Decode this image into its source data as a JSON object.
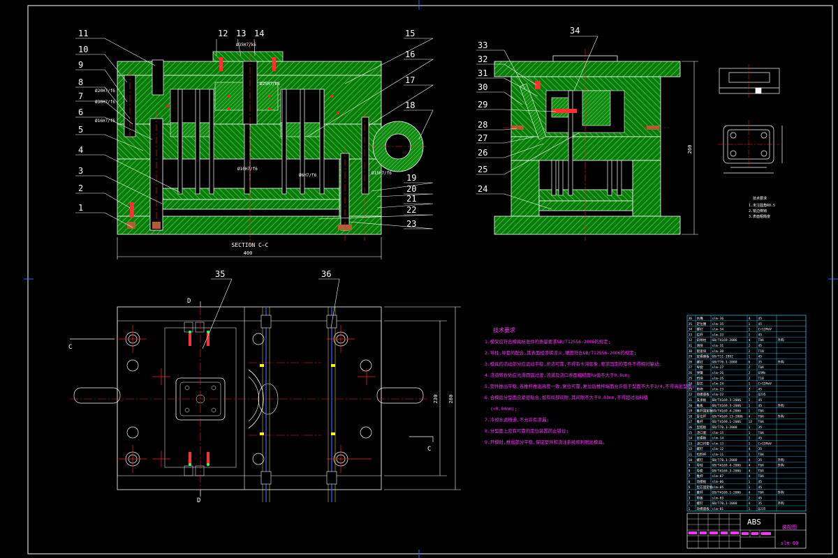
{
  "colors": {
    "background": "#000000",
    "frame": "#ffffff",
    "hatch": "#00c000",
    "hatch_dark": "#007a00",
    "centerline": "#ff2020",
    "notes": "#ff33ff",
    "table": "#33ccff",
    "yellow": "#ffff00",
    "blue_guides": "#4060ff"
  },
  "balloons_left": [
    "11",
    "10",
    "9",
    "8",
    "7",
    "6",
    "5",
    "4",
    "3",
    "2",
    "1"
  ],
  "balloons_top": [
    "12",
    "13",
    "14",
    "15",
    "16"
  ],
  "balloons_right_main": [
    "17",
    "18",
    "19",
    "20",
    "21",
    "22",
    "23"
  ],
  "balloons_side": [
    "33",
    "32",
    "31",
    "30",
    "29",
    "28",
    "27",
    "26",
    "25",
    "24"
  ],
  "balloon_side_top": "34",
  "balloons_plan": [
    "35",
    "36"
  ],
  "fit_labels": [
    "Ø20H7/f6",
    "Ø30H7/f6",
    "Ø16H7/f6",
    "Ø20H7/f6",
    "Ø35H7/k6",
    "Ø25H7/k6",
    "Ø10H7/f6",
    "Ø6H7/f6",
    "Ø15H7/f6"
  ],
  "section_label": "SECTION C—C",
  "dim_main_width": "400",
  "dim_side_height": "260",
  "plan_dims": [
    "230",
    "280"
  ],
  "plan_marks": {
    "c1": "C",
    "c2": "C",
    "d1": "D",
    "d2": "D"
  },
  "notes_title": "技术要求",
  "notes": [
    "1.模架应符合模具标准件的质量要求GB/T12556-2006的规定;",
    "2.导柱,导套的配合,其表面经渗碳淬火,硬度符合GB/T12556-2006的规定;",
    "3.模具的活动部分应运动平稳,灵活可靠,不得有卡滞现象,要求固定的零件不得相对窜动;",
    "4.浇道转折处应光滑圆弧过渡,流道及浇口表面粗糙度Ra值不大于0.8um;",
    "5.塑件推出平稳,各推杆推出高度一致,复位可靠,复位后推杆端面允许低于型面不大于3/4,不得高出型面;",
    "6.合模后分型面应紧密贴合,如有局部间隙,其间隙不大于0.03mm,不得超过溢料值",
    "(<0.04mm);",
    "7.冷却水道畅通,不允许有渗漏;",
    "8.分型面上应有可靠的定位装置防止错位;",
    "9.开模时,推出部分平稳,保证塑件和浇注系统顺利脱出模具。"
  ],
  "mini_note_title": "技术要求",
  "mini_notes": [
    "1.未注圆角R0.5",
    "2.锐边倒钝",
    "3.表面粗糙度"
  ],
  "bom_rows": [
    [
      "36",
      "水嘴",
      "slm-36",
      "4",
      "45",
      ""
    ],
    [
      "35",
      "定位圈",
      "slm-35",
      "1",
      "45",
      ""
    ],
    [
      "34",
      "螺钉",
      "slm-34",
      "1",
      "Cr12MoV",
      ""
    ],
    [
      "33",
      "拉杆",
      "slm-33",
      "1",
      "45",
      ""
    ],
    [
      "32",
      "斜导柱",
      "GB/T4169-2006",
      "4",
      "T8A",
      "外购"
    ],
    [
      "31",
      "滑块",
      "slm-31",
      "2",
      "45",
      ""
    ],
    [
      "30",
      "锁紧块",
      "slm-30",
      "2",
      "T10",
      ""
    ],
    [
      "29",
      "定模座板",
      "GB/T11-1992",
      "1",
      "45",
      ""
    ],
    [
      "28",
      "螺钉",
      "GB/T70.1-2000",
      "6",
      "35",
      "外购"
    ],
    [
      "27",
      "导套",
      "slm-27",
      "2",
      "T8A",
      ""
    ],
    [
      "26",
      "弹簧",
      "slm-26",
      "2",
      "65Mn",
      ""
    ],
    [
      "25",
      "挡块",
      "slm-25",
      "2",
      "T10",
      ""
    ],
    [
      "24",
      "型芯",
      "slm-24",
      "1",
      "Cr12MoV",
      ""
    ],
    [
      "23",
      "垫块",
      "slm-23",
      "2",
      "45",
      ""
    ],
    [
      "22",
      "动模座板",
      "slm-22",
      "1",
      "Q235",
      ""
    ],
    [
      "21",
      "支承板",
      "GB/T4169.3-2006",
      "1",
      "45",
      ""
    ],
    [
      "20",
      "推板",
      "GB/T4169.3-2006",
      "1",
      "45",
      "外购"
    ],
    [
      "19",
      "推杆固定板",
      "GB/T4169.4-2006",
      "1",
      "T8A",
      ""
    ],
    [
      "18",
      "复位杆",
      "GB/T4169.13-2006",
      "4",
      "T8A",
      "外购"
    ],
    [
      "17",
      "推杆",
      "GB/T4169.1-2006",
      "12",
      "T8A",
      ""
    ],
    [
      "16",
      "型腔板",
      "GB/T70.1-2000",
      "1",
      "35",
      ""
    ],
    [
      "15",
      "浇口套",
      "slm-15",
      "1",
      "T8A",
      ""
    ],
    [
      "14",
      "定模板",
      "slm-14",
      "1",
      "45",
      ""
    ],
    [
      "13",
      "浇口衬套",
      "slm-13",
      "1",
      "Cr12MoV",
      ""
    ],
    [
      "12",
      "螺钉",
      "slm-12",
      "4",
      "35",
      ""
    ],
    [
      "11",
      "拉料杆",
      "slm-11",
      "1",
      "T8A",
      ""
    ],
    [
      "10",
      "螺钉",
      "GB/T70.1-2000",
      "4",
      "35",
      "外购"
    ],
    [
      "9",
      "导柱",
      "GB/T4169.4-2006",
      "4",
      "T8A",
      "外购"
    ],
    [
      "8",
      "导套",
      "GB/T4169.3-2006",
      "4",
      "T8A",
      ""
    ],
    [
      "7",
      "推杆",
      "slm-07",
      "4",
      "T8A",
      ""
    ],
    [
      "6",
      "动模板",
      "slm-06",
      "1",
      "45",
      ""
    ],
    [
      "5",
      "型芯固定板",
      "slm-05",
      "1",
      "45",
      ""
    ],
    [
      "4",
      "推杆",
      "GB/T4169.1-2006",
      "4",
      "T8A",
      "外购"
    ],
    [
      "3",
      "垫板",
      "slm-03",
      "2",
      "45",
      ""
    ],
    [
      "2",
      "螺钉",
      "GB/T70.1-2000",
      "4",
      "35",
      "外购"
    ],
    [
      "1",
      "动模座板",
      "slm-01",
      "1",
      "Q235",
      ""
    ]
  ],
  "title_block": {
    "material": "ABS",
    "drawing_name": "装配图",
    "drawing_no": "slm-00"
  }
}
